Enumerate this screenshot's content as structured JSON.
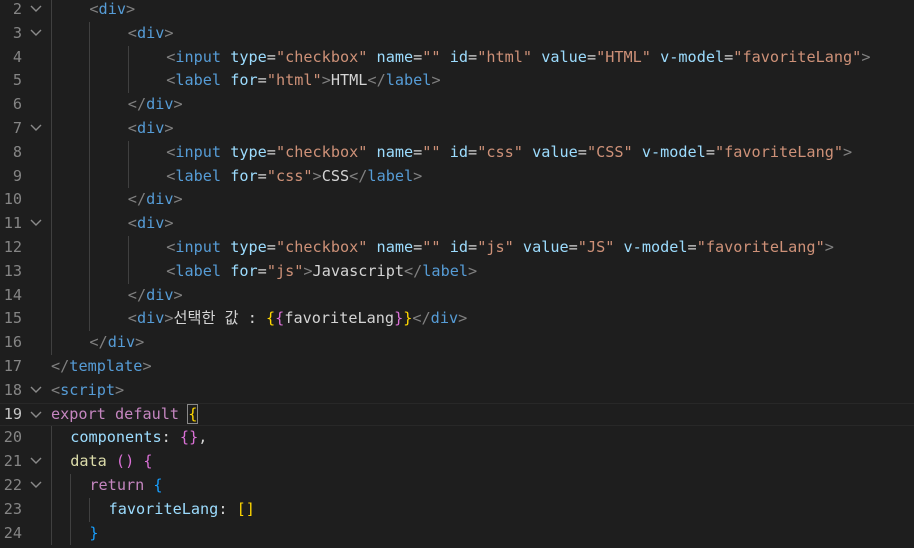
{
  "colors": {
    "background": "#1e1e1e",
    "line_number": "#858585",
    "line_number_active": "#c6c6c6",
    "tag": "#569cd6",
    "punctuation": "#808080",
    "attribute": "#9cdcfe",
    "string": "#ce9178",
    "text": "#d4d4d4",
    "keyword": "#c586c0",
    "function": "#dcdcaa",
    "bracket_gold": "#ffd700",
    "bracket_orchid": "#da70d6",
    "bracket_blue": "#179fff"
  },
  "active_line": "19",
  "lines": [
    {
      "n": "2",
      "fold": true,
      "indent": 2,
      "tokens": [
        [
          "punc",
          "<"
        ],
        [
          "tag",
          "div"
        ],
        [
          "punc",
          ">"
        ]
      ]
    },
    {
      "n": "3",
      "fold": true,
      "indent": 4,
      "tokens": [
        [
          "punc",
          "<"
        ],
        [
          "tag",
          "div"
        ],
        [
          "punc",
          ">"
        ]
      ]
    },
    {
      "n": "4",
      "fold": false,
      "indent": 6,
      "tokens": [
        [
          "punc",
          "<"
        ],
        [
          "tag",
          "input"
        ],
        [
          "text",
          " "
        ],
        [
          "attr",
          "type"
        ],
        [
          "text",
          "="
        ],
        [
          "str",
          "\"checkbox\""
        ],
        [
          "text",
          " "
        ],
        [
          "attr",
          "name"
        ],
        [
          "text",
          "="
        ],
        [
          "str",
          "\"\""
        ],
        [
          "text",
          " "
        ],
        [
          "attr",
          "id"
        ],
        [
          "text",
          "="
        ],
        [
          "str",
          "\"html\""
        ],
        [
          "text",
          " "
        ],
        [
          "attr",
          "value"
        ],
        [
          "text",
          "="
        ],
        [
          "str",
          "\"HTML\""
        ],
        [
          "text",
          " "
        ],
        [
          "attr",
          "v-model"
        ],
        [
          "text",
          "="
        ],
        [
          "str",
          "\"favoriteLang\""
        ],
        [
          "punc",
          ">"
        ]
      ]
    },
    {
      "n": "5",
      "fold": false,
      "indent": 6,
      "tokens": [
        [
          "punc",
          "<"
        ],
        [
          "tag",
          "label"
        ],
        [
          "text",
          " "
        ],
        [
          "attr",
          "for"
        ],
        [
          "text",
          "="
        ],
        [
          "str",
          "\"html\""
        ],
        [
          "punc",
          ">"
        ],
        [
          "text",
          "HTML"
        ],
        [
          "punc",
          "</"
        ],
        [
          "tag",
          "label"
        ],
        [
          "punc",
          ">"
        ]
      ]
    },
    {
      "n": "6",
      "fold": false,
      "indent": 4,
      "tokens": [
        [
          "punc",
          "</"
        ],
        [
          "tag",
          "div"
        ],
        [
          "punc",
          ">"
        ]
      ]
    },
    {
      "n": "7",
      "fold": true,
      "indent": 4,
      "tokens": [
        [
          "punc",
          "<"
        ],
        [
          "tag",
          "div"
        ],
        [
          "punc",
          ">"
        ]
      ]
    },
    {
      "n": "8",
      "fold": false,
      "indent": 6,
      "tokens": [
        [
          "punc",
          "<"
        ],
        [
          "tag",
          "input"
        ],
        [
          "text",
          " "
        ],
        [
          "attr",
          "type"
        ],
        [
          "text",
          "="
        ],
        [
          "str",
          "\"checkbox\""
        ],
        [
          "text",
          " "
        ],
        [
          "attr",
          "name"
        ],
        [
          "text",
          "="
        ],
        [
          "str",
          "\"\""
        ],
        [
          "text",
          " "
        ],
        [
          "attr",
          "id"
        ],
        [
          "text",
          "="
        ],
        [
          "str",
          "\"css\""
        ],
        [
          "text",
          " "
        ],
        [
          "attr",
          "value"
        ],
        [
          "text",
          "="
        ],
        [
          "str",
          "\"CSS\""
        ],
        [
          "text",
          " "
        ],
        [
          "attr",
          "v-model"
        ],
        [
          "text",
          "="
        ],
        [
          "str",
          "\"favoriteLang\""
        ],
        [
          "punc",
          ">"
        ]
      ]
    },
    {
      "n": "9",
      "fold": false,
      "indent": 6,
      "tokens": [
        [
          "punc",
          "<"
        ],
        [
          "tag",
          "label"
        ],
        [
          "text",
          " "
        ],
        [
          "attr",
          "for"
        ],
        [
          "text",
          "="
        ],
        [
          "str",
          "\"css\""
        ],
        [
          "punc",
          ">"
        ],
        [
          "text",
          "CSS"
        ],
        [
          "punc",
          "</"
        ],
        [
          "tag",
          "label"
        ],
        [
          "punc",
          ">"
        ]
      ]
    },
    {
      "n": "10",
      "fold": false,
      "indent": 4,
      "tokens": [
        [
          "punc",
          "</"
        ],
        [
          "tag",
          "div"
        ],
        [
          "punc",
          ">"
        ]
      ]
    },
    {
      "n": "11",
      "fold": true,
      "indent": 4,
      "tokens": [
        [
          "punc",
          "<"
        ],
        [
          "tag",
          "div"
        ],
        [
          "punc",
          ">"
        ]
      ]
    },
    {
      "n": "12",
      "fold": false,
      "indent": 6,
      "tokens": [
        [
          "punc",
          "<"
        ],
        [
          "tag",
          "input"
        ],
        [
          "text",
          " "
        ],
        [
          "attr",
          "type"
        ],
        [
          "text",
          "="
        ],
        [
          "str",
          "\"checkbox\""
        ],
        [
          "text",
          " "
        ],
        [
          "attr",
          "name"
        ],
        [
          "text",
          "="
        ],
        [
          "str",
          "\"\""
        ],
        [
          "text",
          " "
        ],
        [
          "attr",
          "id"
        ],
        [
          "text",
          "="
        ],
        [
          "str",
          "\"js\""
        ],
        [
          "text",
          " "
        ],
        [
          "attr",
          "value"
        ],
        [
          "text",
          "="
        ],
        [
          "str",
          "\"JS\""
        ],
        [
          "text",
          " "
        ],
        [
          "attr",
          "v-model"
        ],
        [
          "text",
          "="
        ],
        [
          "str",
          "\"favoriteLang\""
        ],
        [
          "punc",
          ">"
        ]
      ]
    },
    {
      "n": "13",
      "fold": false,
      "indent": 6,
      "tokens": [
        [
          "punc",
          "<"
        ],
        [
          "tag",
          "label"
        ],
        [
          "text",
          " "
        ],
        [
          "attr",
          "for"
        ],
        [
          "text",
          "="
        ],
        [
          "str",
          "\"js\""
        ],
        [
          "punc",
          ">"
        ],
        [
          "text",
          "Javascript"
        ],
        [
          "punc",
          "</"
        ],
        [
          "tag",
          "label"
        ],
        [
          "punc",
          ">"
        ]
      ]
    },
    {
      "n": "14",
      "fold": false,
      "indent": 4,
      "tokens": [
        [
          "punc",
          "</"
        ],
        [
          "tag",
          "div"
        ],
        [
          "punc",
          ">"
        ]
      ]
    },
    {
      "n": "15",
      "fold": false,
      "indent": 4,
      "tokens": [
        [
          "punc",
          "<"
        ],
        [
          "tag",
          "div"
        ],
        [
          "punc",
          ">"
        ],
        [
          "text",
          "선택한 값 : "
        ],
        [
          "b1",
          "{"
        ],
        [
          "b2",
          "{"
        ],
        [
          "text",
          "favoriteLang"
        ],
        [
          "b2",
          "}"
        ],
        [
          "b1",
          "}"
        ],
        [
          "punc",
          "</"
        ],
        [
          "tag",
          "div"
        ],
        [
          "punc",
          ">"
        ]
      ]
    },
    {
      "n": "16",
      "fold": false,
      "indent": 2,
      "tokens": [
        [
          "punc",
          "</"
        ],
        [
          "tag",
          "div"
        ],
        [
          "punc",
          ">"
        ]
      ]
    },
    {
      "n": "17",
      "fold": false,
      "indent": 0,
      "tokens": [
        [
          "punc",
          "</"
        ],
        [
          "tag",
          "template"
        ],
        [
          "punc",
          ">"
        ]
      ]
    },
    {
      "n": "18",
      "fold": true,
      "indent": 0,
      "tokens": [
        [
          "punc",
          "<"
        ],
        [
          "tag",
          "script"
        ],
        [
          "punc",
          ">"
        ]
      ]
    },
    {
      "n": "19",
      "fold": true,
      "indent": 0,
      "tokens": [
        [
          "kw",
          "export"
        ],
        [
          "text",
          " "
        ],
        [
          "kw",
          "default"
        ],
        [
          "text",
          " "
        ],
        [
          "b1m",
          "{"
        ]
      ]
    },
    {
      "n": "20",
      "fold": false,
      "indent": 1,
      "tokens": [
        [
          "prop",
          "components"
        ],
        [
          "text",
          ": "
        ],
        [
          "b2",
          "{}"
        ],
        [
          "text",
          ","
        ]
      ]
    },
    {
      "n": "21",
      "fold": true,
      "indent": 1,
      "tokens": [
        [
          "func",
          "data"
        ],
        [
          "text",
          " "
        ],
        [
          "b2",
          "()"
        ],
        [
          "text",
          " "
        ],
        [
          "b2",
          "{"
        ]
      ]
    },
    {
      "n": "22",
      "fold": true,
      "indent": 2,
      "tokens": [
        [
          "kw",
          "return"
        ],
        [
          "text",
          " "
        ],
        [
          "b3",
          "{"
        ]
      ]
    },
    {
      "n": "23",
      "fold": false,
      "indent": 3,
      "tokens": [
        [
          "prop",
          "favoriteLang"
        ],
        [
          "text",
          ": "
        ],
        [
          "b1",
          "[]"
        ]
      ]
    },
    {
      "n": "24",
      "fold": false,
      "indent": 2,
      "tokens": [
        [
          "b3",
          "}"
        ]
      ]
    }
  ]
}
